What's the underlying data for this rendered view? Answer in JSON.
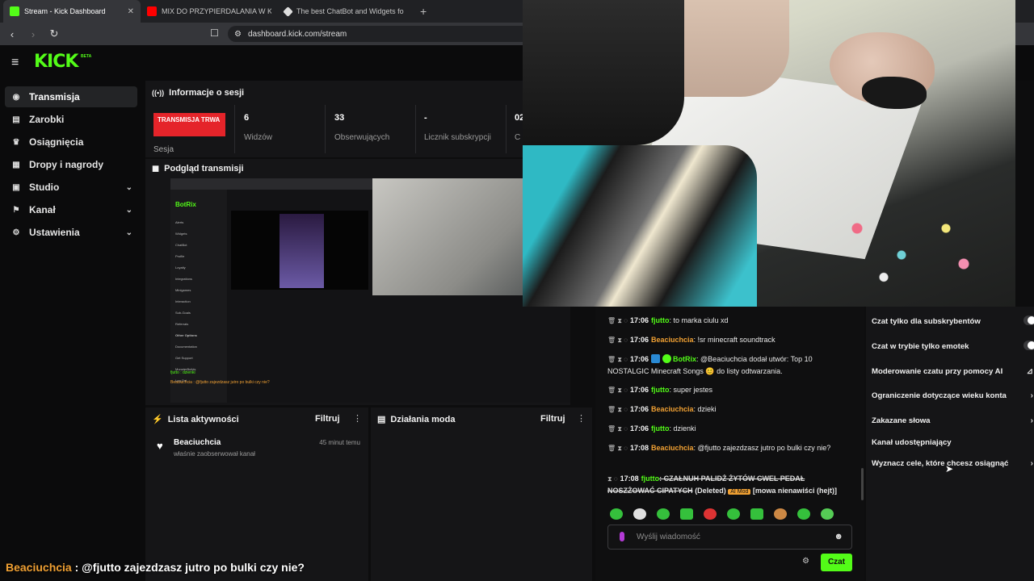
{
  "browser": {
    "tabs": [
      {
        "title": "Stream - Kick Dashboard",
        "color": "#53fc18"
      },
      {
        "title": "MIX DO PRZYPIERDALANIA W KRAW",
        "color": "#ff0000"
      },
      {
        "title": "The best ChatBot and Widgets fo",
        "color": "#dddddd"
      }
    ],
    "url": "dashboard.kick.com/stream"
  },
  "header": {
    "logo": "KICK",
    "beta": "BETA"
  },
  "sidebar": {
    "items": [
      {
        "label": "Transmisja",
        "icon": "broadcast-icon"
      },
      {
        "label": "Zarobki",
        "icon": "chart-icon"
      },
      {
        "label": "Osiągnięcia",
        "icon": "trophy-icon"
      },
      {
        "label": "Dropy i nagrody",
        "icon": "gift-icon"
      },
      {
        "label": "Studio",
        "icon": "studio-icon"
      },
      {
        "label": "Kanał",
        "icon": "channel-icon"
      },
      {
        "label": "Ustawienia",
        "icon": "gear-icon"
      }
    ]
  },
  "session": {
    "title": "Informacje o sesji",
    "live_badge": "TRANSMISJA TRWA",
    "label": "Sesja",
    "stats": [
      {
        "value": "6",
        "label": "Widzów"
      },
      {
        "value": "33",
        "label": "Obserwujących"
      },
      {
        "value": "-",
        "label": "Licznik subskrypcji"
      },
      {
        "value": "02",
        "label": "C"
      }
    ]
  },
  "preview": {
    "title": "Podgląd transmisji",
    "app_name": "BotRix",
    "menu": [
      "Alerts",
      "Widgets",
      "ChatBot",
      "Profile",
      "Loyalty",
      "Integrations",
      "Minigames",
      "Interaction",
      "Sub-Goals",
      "Referrals",
      "Other Options",
      "Documentation",
      "Get Support",
      "MonsterBuilds",
      "Log Out"
    ],
    "chat_lines": [
      "fjutto : dzienki",
      "Beaciuchcia : @fjutto zajezdzasz jutro po bulki czy nie?"
    ]
  },
  "activity": {
    "title": "Lista aktywności",
    "filter": "Filtruj",
    "entries": [
      {
        "name": "Beaciuchcia",
        "text": "właśnie zaobserwował kanał",
        "time": "45 minut temu"
      }
    ]
  },
  "mod_actions": {
    "title": "Działania moda",
    "filter": "Filtruj"
  },
  "chat": {
    "messages": [
      {
        "time": "17:06",
        "user": "fjutto",
        "text": ": to marka ciulu xd"
      },
      {
        "time": "17:06",
        "user": "Beaciuchcia",
        "text": ": !sr minecraft soundtrack"
      },
      {
        "time": "17:06",
        "user": "BotRix",
        "text": ": @Beaciuchcia dodał utwór: Top 10 NOSTALGIC Minecraft Songs 😊 do listy odtwarzania."
      },
      {
        "time": "17:06",
        "user": "fjutto",
        "text": ": super jestes"
      },
      {
        "time": "17:06",
        "user": "Beaciuchcia",
        "text": ": dzieki"
      },
      {
        "time": "17:06",
        "user": "fjutto",
        "text": ": dzienki"
      },
      {
        "time": "17:08",
        "user": "Beaciuchcia",
        "text": ": @fjutto zajezdzasz jutro po bulki czy nie?"
      }
    ],
    "deleted": {
      "time": "17:08",
      "user": "fjutto",
      "text": ": CZAŁNUH PALIDŻ ŻYTÓW CWEL PEDAŁ NOSZŻOWAĆ CIPATYCH",
      "deleted_label": "(Deleted)",
      "badge": "AI Mod",
      "reason": "[mowa nienawiści (hejt)]"
    },
    "input_placeholder": "Wyślij wiadomość",
    "send_label": "Czat",
    "colors": {
      "green": "#53fc18",
      "orange": "#f0a033"
    }
  },
  "settings": {
    "rows": [
      {
        "label": "Czat tylko dla subskrybentów",
        "control": "toggle"
      },
      {
        "label": "Czat w trybie tylko emotek",
        "control": "toggle"
      },
      {
        "label": "Moderowanie czatu przy pomocy AI",
        "control": "none"
      },
      {
        "label": "Ograniczenie dotyczące wieku konta",
        "control": "chevron"
      },
      {
        "label": "Zakazane słowa",
        "control": "chevron"
      },
      {
        "label": "Kanał udostępniający",
        "control": "none"
      },
      {
        "label": "Wyznacz cele, które chcesz osiągnąć",
        "control": "chevron"
      }
    ]
  },
  "caption": {
    "user": "Beaciuchcia",
    "text": " : @fjutto zajezdzasz jutro po bulki czy nie?"
  }
}
